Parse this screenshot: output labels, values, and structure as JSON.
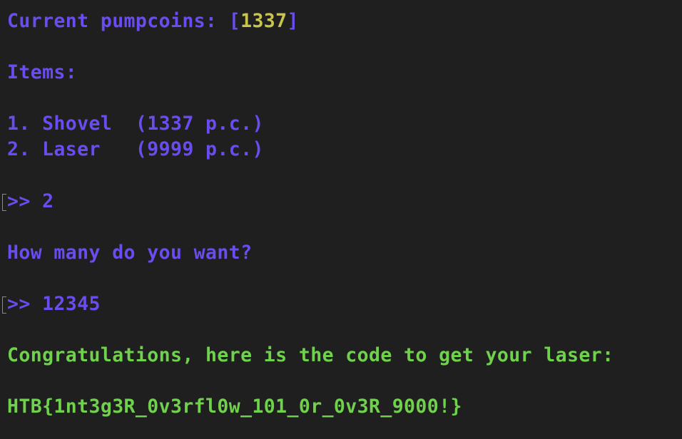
{
  "colors": {
    "background": "#1f1f1f",
    "primary": "#6b4cf0",
    "highlight": "#c9c44a",
    "success": "#6fd14c"
  },
  "header": {
    "label": "Current pumpcoins: [",
    "value": "1337",
    "suffix": "]"
  },
  "items_title": "Items:",
  "items": [
    {
      "text": "1. Shovel  (1337 p.c.)"
    },
    {
      "text": "2. Laser   (9999 p.c.)"
    }
  ],
  "prompt1": {
    "symbol": ">>",
    "value": "2"
  },
  "question": "How many do you want?",
  "prompt2": {
    "symbol": ">>",
    "value": "12345"
  },
  "congrats": "Congratulations, here is the code to get your laser:",
  "flag": "HTB{1nt3g3R_0v3rfl0w_101_0r_0v3R_9000!}"
}
